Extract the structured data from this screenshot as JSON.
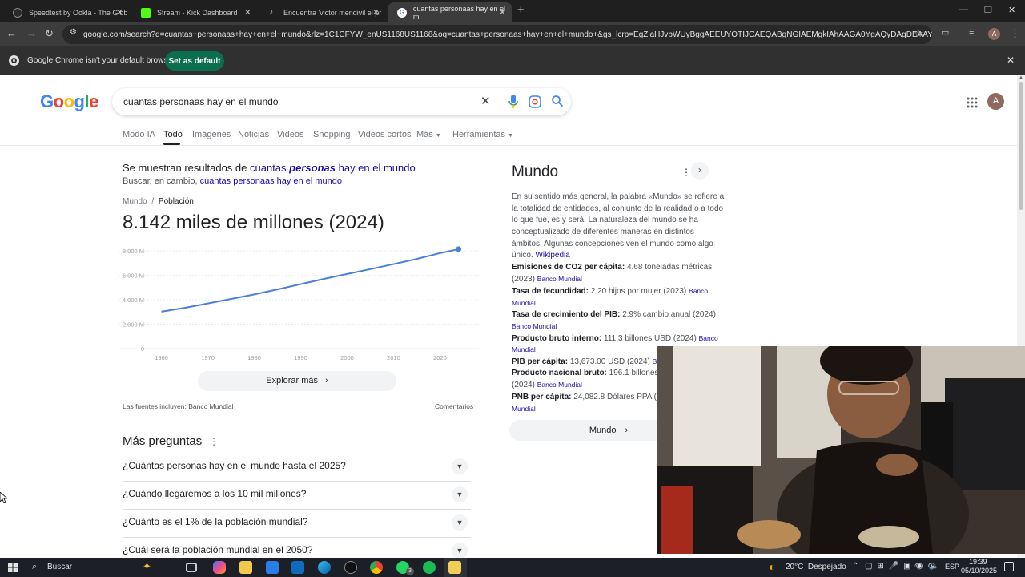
{
  "browser": {
    "tabs": [
      {
        "title": "Speedtest by Ookla - The Glob",
        "favicon_color": "#2a2a2a"
      },
      {
        "title": "Stream - Kick Dashboard",
        "favicon_color": "#53fc18"
      },
      {
        "title": "Encuentra 'victor mendivil el pr",
        "favicon_color": "#ffffff"
      },
      {
        "title": "cuantas personaas hay en el m",
        "favicon_color": "#4285f4"
      }
    ],
    "new_tab": "+",
    "url": "google.com/search?q=cuantas+personaas+hay+en+el+mundo&rlz=1C1CFYW_enUS1168US1168&oq=cuantas+personaas+hay+en+el+mundo+&gs_lcrp=EgZjaHJvbWUyBggAEEUYOTIJCAEQABgNGIAEMgkIAhAAGA0YgAQyDAgDEAAYDRiLAxiABDI",
    "infobar": {
      "message": "Google Chrome isn't your default browser",
      "button": "Set as default"
    },
    "profile_initial": "A"
  },
  "search": {
    "logo": [
      "G",
      "o",
      "o",
      "g",
      "l",
      "e"
    ],
    "logo_colors": [
      "#4285f4",
      "#ea4335",
      "#fbbc05",
      "#4285f4",
      "#34a853",
      "#ea4335"
    ],
    "query": "cuantas personaas hay en el mundo",
    "tabs": [
      "Modo IA",
      "Todo",
      "Imágenes",
      "Noticias",
      "Videos",
      "Shopping",
      "Videos cortos",
      "Más",
      "Herramientas"
    ],
    "correction": {
      "prefix": "Se muestran resultados de",
      "corrected_pre": "cuantas",
      "corrected_bold": "personas",
      "corrected_post": "hay en el mundo",
      "instead_prefix": "Buscar, en cambio,",
      "instead_link": "cuantas personaas hay en el mundo"
    },
    "breadcrumb": [
      "Mundo",
      "/",
      "Población"
    ],
    "headline": "8.142 miles de millones (2024)",
    "explore_more": "Explorar más",
    "sources": "Las fuentes incluyen: Banco Mundial",
    "feedback": "Comentarios",
    "more_questions_title": "Más preguntas",
    "questions": [
      "¿Cuántas personas hay en el mundo hasta el 2025?",
      "¿Cuándo llegaremos a los 10 mil millones?",
      "¿Cuánto es el 1% de la población mundial?",
      "¿Cuál será la población mundial en el 2050?"
    ]
  },
  "chart_data": {
    "type": "line",
    "title": "",
    "xlabel": "",
    "ylabel": "",
    "x_ticks": [
      "1960",
      "1970",
      "1980",
      "1990",
      "2000",
      "2010",
      "2020"
    ],
    "y_ticks": [
      "0",
      "2.000 M",
      "4.000 M",
      "6.000 M",
      "8.000 M"
    ],
    "xlim": [
      1958,
      2027
    ],
    "ylim": [
      0,
      8400
    ],
    "grid": true,
    "series": [
      {
        "color": "#4a7fd9",
        "x": [
          1960,
          1965,
          1970,
          1975,
          1980,
          1985,
          1990,
          1995,
          2000,
          2005,
          2010,
          2015,
          2020,
          2024
        ],
        "y": [
          3030,
          3340,
          3700,
          4070,
          4440,
          4850,
          5280,
          5710,
          6110,
          6510,
          6920,
          7340,
          7820,
          8142
        ]
      }
    ]
  },
  "knowledge_panel": {
    "title": "Mundo",
    "description_lines": [
      "En su sentido más general, la palabra «Mundo» se refiere a",
      "la totalidad de entidades, al conjunto de la realidad o a todo",
      "lo que fue, es y será. La naturaleza del mundo se ha",
      "conceptualizado de diferentes maneras en distintos",
      "ámbitos. Algunas concepciones ven el mundo como algo",
      "único."
    ],
    "wikipedia": "Wikipedia",
    "facts": [
      {
        "label": "Emisiones de CO2 per cápita:",
        "value": "4.68 toneladas métricas",
        "value2": "(2023)",
        "source": "Banco Mundial"
      },
      {
        "label": "Tasa de fecundidad:",
        "value": "2.20 hijos por mujer (2023)",
        "source_a": "Banco",
        "source_b": "Mundial"
      },
      {
        "label": "Tasa de crecimiento del PIB:",
        "value": "2.9% cambio anual (2024)",
        "source": "Banco Mundial"
      },
      {
        "label": "Producto bruto interno:",
        "value": "111.3 billones USD (2024)",
        "source_a": "Banco",
        "source_b": "Mundial"
      },
      {
        "label": "PIB per cápita:",
        "value": "13,673.00 USD (2024)",
        "source": "Banco"
      },
      {
        "label": "Producto nacional bruto:",
        "value": "196.1 billones D",
        "value2": "(2024)",
        "source": "Banco Mundial"
      },
      {
        "label": "PNB per cápita:",
        "value": "24,082.8 Dólares PPA (202",
        "source": "Mundial"
      }
    ],
    "button": "Mundo"
  },
  "taskbar": {
    "search": "Buscar",
    "weather": "20°C  Despejado",
    "lang": "ESP",
    "time": "19:39",
    "date": "05/10/2025",
    "whatsapp_badge": "3"
  }
}
